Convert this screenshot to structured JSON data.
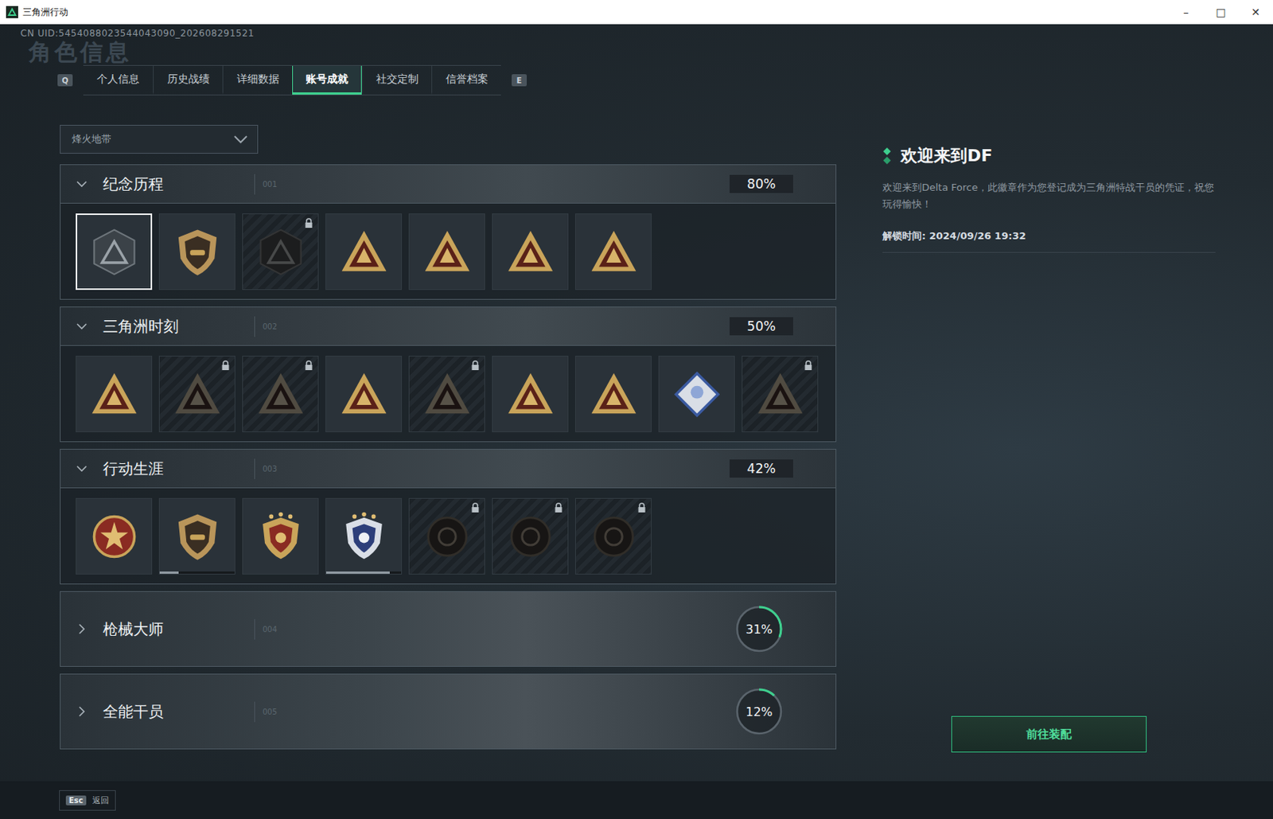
{
  "window": {
    "title": "三角洲行动",
    "controls": [
      "–",
      "□",
      "✕"
    ]
  },
  "uid": "CN UID:5454088023544043090_202608291521",
  "watermark": "角色信息",
  "tabs": {
    "prev_key": "Q",
    "next_key": "E",
    "items": [
      {
        "label": "个人信息",
        "selected": false
      },
      {
        "label": "历史战绩",
        "selected": false
      },
      {
        "label": "详细数据",
        "selected": false
      },
      {
        "label": "账号成就",
        "selected": true
      },
      {
        "label": "社交定制",
        "selected": false
      },
      {
        "label": "信誉档案",
        "selected": false
      }
    ]
  },
  "mode_select": {
    "value": "烽火地带",
    "expanded": false
  },
  "sections": [
    {
      "title": "纪念历程",
      "code": "001",
      "percent": "80%",
      "expanded": true,
      "badges": [
        {
          "kind": "hex",
          "locked": false,
          "selected": true
        },
        {
          "kind": "shield",
          "locked": false,
          "selected": false
        },
        {
          "kind": "hex",
          "locked": true,
          "selected": false
        },
        {
          "kind": "triangle",
          "locked": false,
          "selected": false
        },
        {
          "kind": "triangle",
          "locked": false,
          "selected": false
        },
        {
          "kind": "triangle",
          "locked": false,
          "selected": false
        },
        {
          "kind": "triangle",
          "locked": false,
          "selected": false
        }
      ]
    },
    {
      "title": "三角洲时刻",
      "code": "002",
      "percent": "50%",
      "expanded": true,
      "badges": [
        {
          "kind": "triangle",
          "locked": false,
          "selected": false
        },
        {
          "kind": "triangle",
          "locked": true,
          "selected": false
        },
        {
          "kind": "triangle",
          "locked": true,
          "selected": false
        },
        {
          "kind": "triangle",
          "locked": false,
          "selected": false
        },
        {
          "kind": "triangle",
          "locked": true,
          "selected": false
        },
        {
          "kind": "triangle",
          "locked": false,
          "selected": false
        },
        {
          "kind": "triangle",
          "locked": false,
          "selected": false
        },
        {
          "kind": "diamond",
          "locked": false,
          "selected": false
        },
        {
          "kind": "triangle",
          "locked": true,
          "selected": false
        }
      ]
    },
    {
      "title": "行动生涯",
      "code": "003",
      "percent": "42%",
      "expanded": true,
      "badges": [
        {
          "kind": "star",
          "locked": false,
          "selected": false
        },
        {
          "kind": "shield",
          "locked": false,
          "selected": false,
          "level": 0.25
        },
        {
          "kind": "crest",
          "locked": false,
          "selected": false
        },
        {
          "kind": "bluecrest",
          "locked": false,
          "selected": false,
          "level": 0.85
        },
        {
          "kind": "round",
          "locked": true,
          "selected": false
        },
        {
          "kind": "round",
          "locked": true,
          "selected": false
        },
        {
          "kind": "round",
          "locked": true,
          "selected": false
        }
      ]
    },
    {
      "title": "枪械大师",
      "code": "004",
      "percent": "31%",
      "expanded": false,
      "level": 0.31,
      "badges": []
    },
    {
      "title": "全能干员",
      "code": "005",
      "percent": "12%",
      "expanded": false,
      "level": 0.12,
      "badges": []
    }
  ],
  "detail": {
    "title": "欢迎来到DF",
    "description": "欢迎来到Delta Force，此徽章作为您登记成为三角洲特战干员的凭证，祝您玩得愉快！",
    "unlock_time": "解锁时间: 2024/09/26 19:32",
    "button": "前往装配"
  },
  "footer": {
    "key": "Esc",
    "label": "返回"
  }
}
